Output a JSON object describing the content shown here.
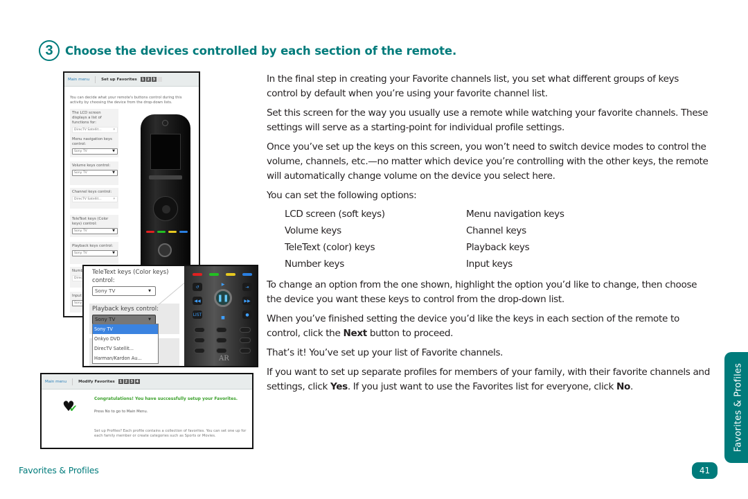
{
  "heading": {
    "step_number": "3",
    "title": "Choose the devices controlled by each section of the remote."
  },
  "screenshot1": {
    "tab_main": "Main menu",
    "tab_active": "Set up Favorites",
    "steps": [
      "1",
      "2",
      "3",
      ""
    ],
    "intro": "You can decide what your remote's buttons control during this activity by choosing the device from the drop-down lists.",
    "fields": [
      {
        "label": "The LCD screen displays a list of functions for:",
        "value": "DirecTV Satellit..."
      },
      {
        "label": "Menu navigation keys control:",
        "value": "Sony TV"
      },
      {
        "label": "Volume keys control:",
        "value": "Sony TV"
      },
      {
        "label": "Channel keys control:",
        "value": "DirecTV Satellit..."
      },
      {
        "label": "TeleText keys (Color keys) control:",
        "value": "Sony TV"
      },
      {
        "label": "Playback keys control:",
        "value": "Sony TV"
      },
      {
        "label": "Numb",
        "value": "DirecT"
      },
      {
        "label": "Input",
        "value": "Sony"
      }
    ]
  },
  "zoom_popup": {
    "teletext_label": "TeleText keys (Color keys) control:",
    "teletext_value": "Sony TV",
    "playback_label": "Playback keys control:",
    "playback_value": "Sony TV",
    "dropdown_options": [
      "Sony TV",
      "Onkyo DVD",
      "DirecTV Satellit...",
      "Harman/Kardon Au..."
    ],
    "dropdown_selected": "Sony TV",
    "remote_logo": "AR",
    "remote_key_list": "LIST"
  },
  "screenshot2": {
    "tab_main": "Main menu",
    "tab_active": "Modify Favorites",
    "steps": [
      "1",
      "2",
      "3",
      "4"
    ],
    "congrats": "Congratulations! You have successfully setup your Favorites.",
    "press_no": "Press No to go to Main Menu.",
    "setup_profiles": "Set up Profiles? Each profile contains a collection of favorites. You can set one up for each family member or create categories such as Sports or Movies."
  },
  "body": {
    "p1": "In the final step in creating your Favorite channels list, you set what different groups of keys control by default when you’re using your favorite channel list.",
    "p2": "Set this screen for the way you usually use a remote while watching your favorite channels. These settings will serve as a starting-point for individual profile settings.",
    "p3": "Once you’ve set up the keys on this screen, you won’t need to switch device modes to control the volume, channels, etc.—no matter which device you’re controlling with the other keys, the remote will automatically change volume on the device you select here.",
    "p4": "You can set the following options:",
    "options": [
      "LCD screen (soft keys)",
      "Menu navigation keys",
      "Volume keys",
      "Channel keys",
      "TeleText (color) keys",
      "Playback keys",
      "Number keys",
      "Input keys"
    ],
    "p5": "To change an option from the one shown, highlight the option you’d like to change, then choose the device you want these keys to control from the drop-down list.",
    "p6_a": "When you’ve finished setting the device you’d like the keys in each section of the remote to control, click the ",
    "p6_bold": "Next",
    "p6_b": " button to proceed.",
    "p7": "That’s it! You’ve set up your list of Favorite channels.",
    "p8_a": "If you want to set up separate profiles for members of your family, with their favorite channels and settings, click ",
    "p8_bold1": "Yes",
    "p8_b": ". If you just want to use the Favorites list for everyone, click ",
    "p8_bold2": "No",
    "p8_c": "."
  },
  "side_tab": "Favorites & Profiles",
  "footer": {
    "section": "Favorites & Profiles",
    "page_number": "41"
  },
  "colors": {
    "accent": "#007b7b",
    "congrats_green": "#3aa02a",
    "link_blue": "#2a7fb8",
    "dropdown_highlight": "#3b83e0"
  }
}
